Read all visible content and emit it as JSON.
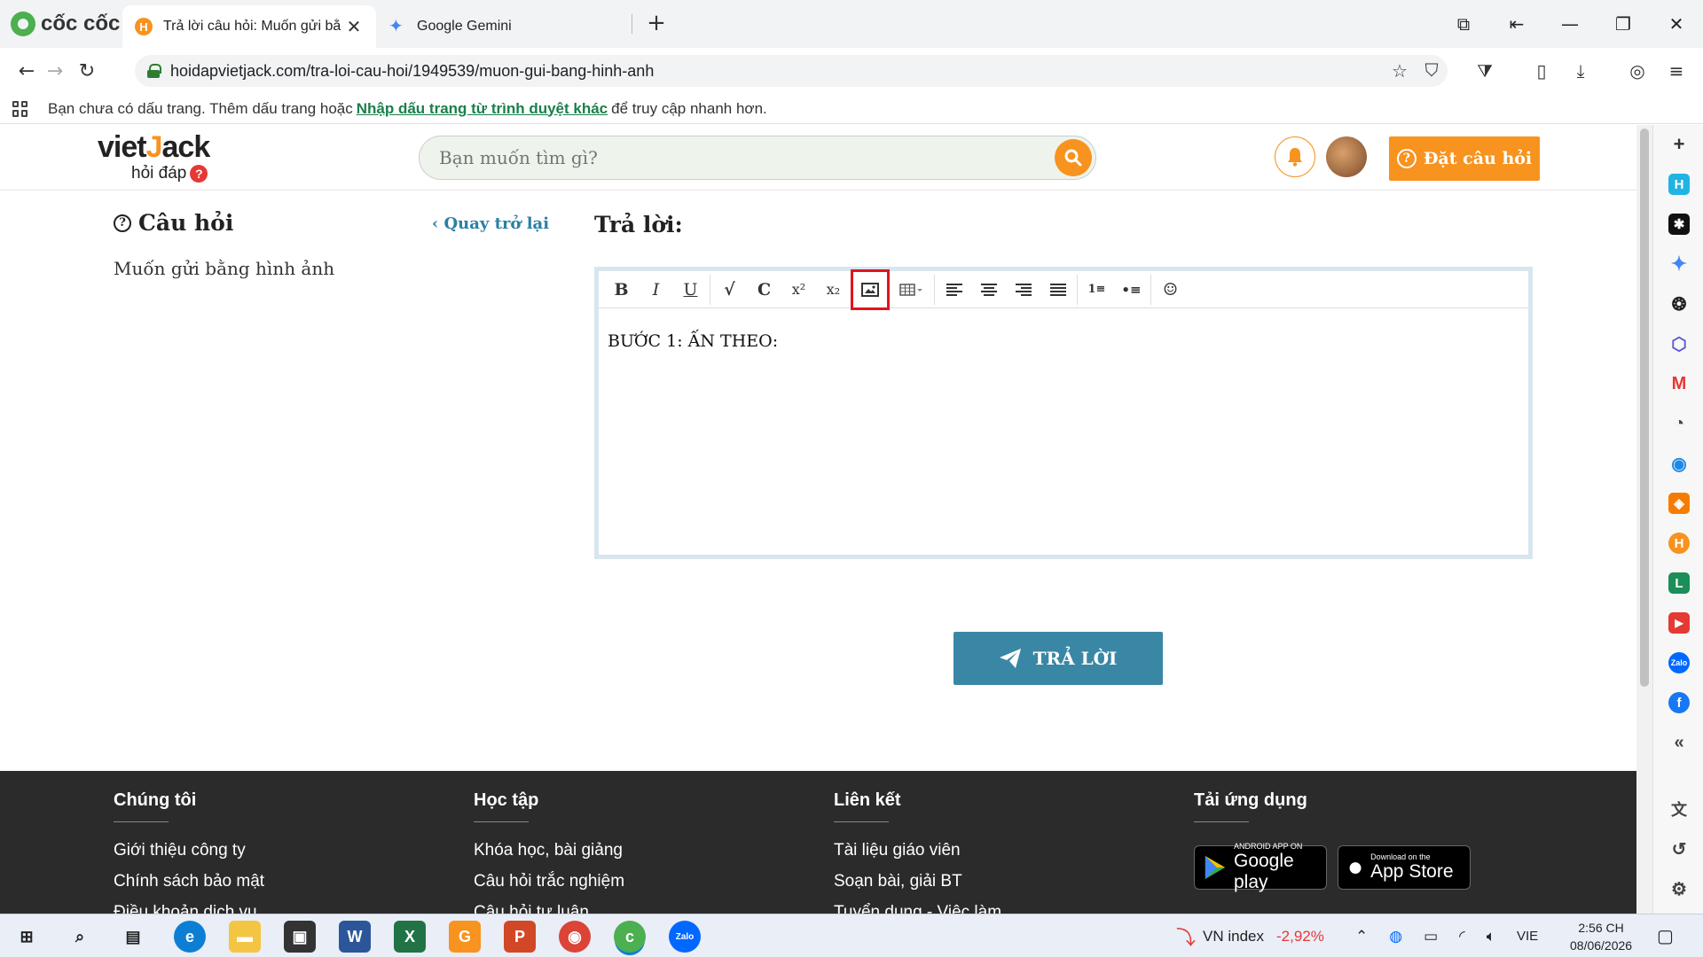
{
  "browser": {
    "brand": "cốc cốc",
    "tabs": [
      {
        "favicon": "H",
        "title": "Trả lời câu hỏi: Muốn gửi bằ"
      },
      {
        "title": "Google Gemini"
      }
    ],
    "url": "hoidapvietjack.com/tra-loi-cau-hoi/1949539/muon-gui-bang-hinh-anh",
    "bookmark_bar": {
      "text_before": "Bạn chưa có dấu trang. Thêm dấu trang hoặc",
      "link": "Nhập dấu trang từ trình duyệt khác",
      "text_after": "để truy cập nhanh hơn."
    }
  },
  "site": {
    "logo_main_a": "viet",
    "logo_main_b": "J",
    "logo_main_c": "ack",
    "logo_sub": "hỏi đáp",
    "search_placeholder": "Bạn muốn tìm gì?",
    "ask_button": "Đặt câu hỏi"
  },
  "question": {
    "heading": "Câu hỏi",
    "back_link": "Quay trở lại",
    "body": "Muốn gửi bằng hình ảnh"
  },
  "answer": {
    "heading": "Trả lời:",
    "editor_content": "BƯỚC 1: ẤN THEO:",
    "submit": "TRẢ LỜI",
    "toolbar": [
      "bold",
      "italic",
      "underline",
      "formula",
      "chemistry",
      "superscript",
      "subscript",
      "image",
      "table",
      "align-left",
      "align-center",
      "align-right",
      "justify",
      "ordered-list",
      "unordered-list",
      "emoji"
    ]
  },
  "footer": {
    "columns": [
      {
        "heading": "Chúng tôi",
        "links": [
          "Giới thiệu công ty",
          "Chính sách bảo mật",
          "Điều khoản dịch vụ"
        ]
      },
      {
        "heading": "Học tập",
        "links": [
          "Khóa học, bài giảng",
          "Câu hỏi trắc nghiệm",
          "Câu hỏi tự luận"
        ]
      },
      {
        "heading": "Liên kết",
        "links": [
          "Tài liệu giáo viên",
          "Soạn bài, giải BT",
          "Tuyển dụng - Việc làm"
        ]
      },
      {
        "heading": "Tải ứng dụng"
      }
    ],
    "google_play": {
      "small": "ANDROID APP ON",
      "big": "Google play"
    },
    "app_store": {
      "small": "Download on the",
      "big": "App Store"
    }
  },
  "taskbar": {
    "stock_label": "VN index",
    "stock_change": "-2,92%",
    "language": "VIE",
    "time": "2:56 CH",
    "date": "08/06/2026"
  },
  "colors": {
    "accent_orange": "#f7931e",
    "reply_blue": "#3a87a5",
    "highlight_red": "#e0141e",
    "footer_bg": "#2b2b2b"
  }
}
